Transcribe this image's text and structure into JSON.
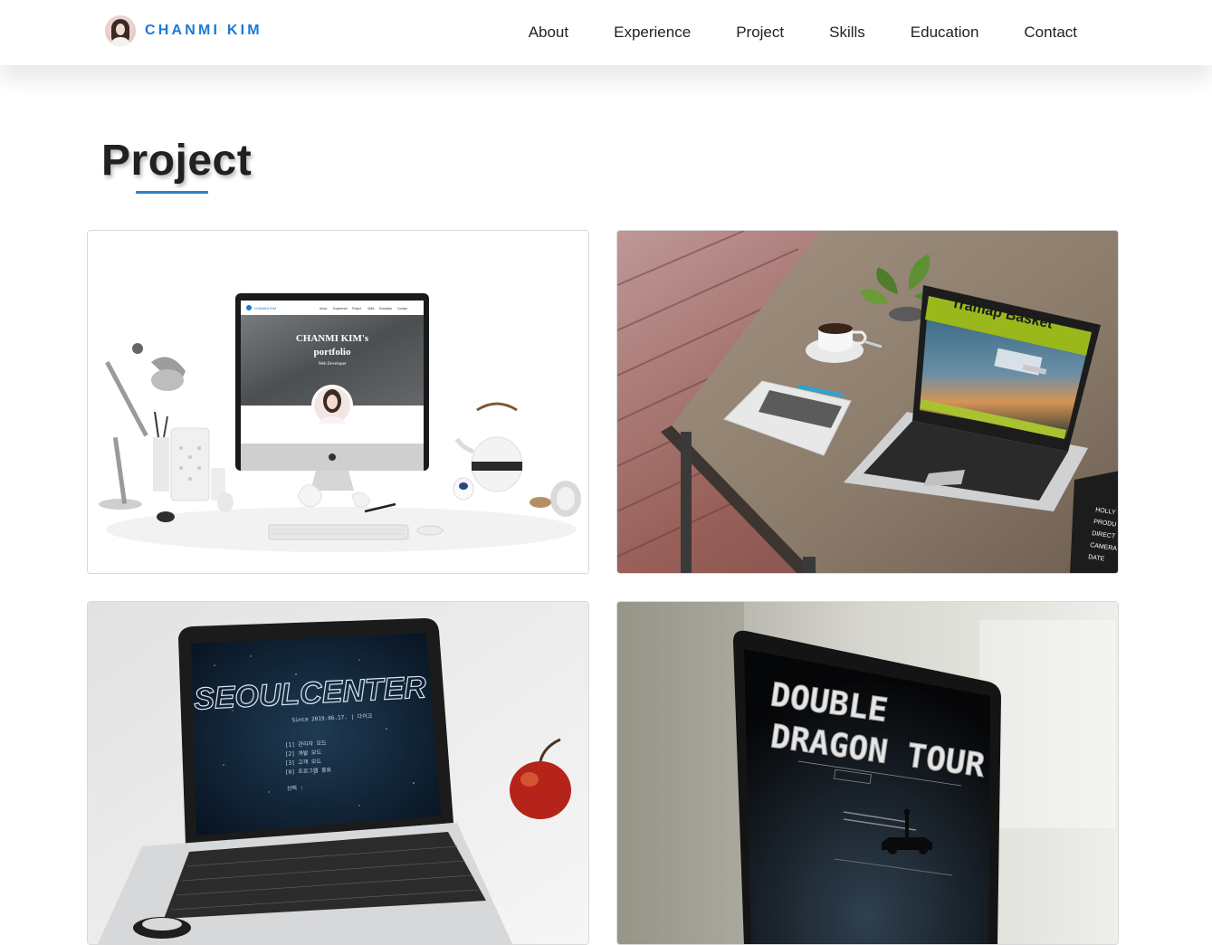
{
  "brand": {
    "name": "CHANMI KIM"
  },
  "nav": {
    "items": [
      "About",
      "Experience",
      "Project",
      "Skills",
      "Education",
      "Contact"
    ]
  },
  "section": {
    "title": "Project"
  },
  "projects": [
    {
      "screen_heading_line1": "CHANMI KIM's",
      "screen_heading_line2": "portfolio",
      "screen_subtitle": "Web Developer",
      "screen_brand": "CHANMI KIM",
      "screen_nav": [
        "About",
        "Experience",
        "Project",
        "Skills",
        "Education",
        "Contact"
      ]
    },
    {
      "screen_title": "Tramap Basket",
      "sign_lines": [
        "HOLLY",
        "PRODU",
        "DIRECT",
        "CAMERA",
        "DATE"
      ]
    },
    {
      "screen_logo": "SEOULCENTER",
      "screen_since": "Since 2019.06.17. | 다이크",
      "screen_menu": [
        "[1] 관리자 모드",
        "[2] 개발 모드",
        "[3] 고객 모드",
        "[0] 프로그램 종료"
      ],
      "screen_prompt": "선택 :"
    },
    {
      "screen_line1": "DOUBLE",
      "screen_line2": "DRAGON TOUR"
    }
  ],
  "colors": {
    "accent": "#1d78d6",
    "underline": "#2f7fc9",
    "title": "#212121"
  }
}
